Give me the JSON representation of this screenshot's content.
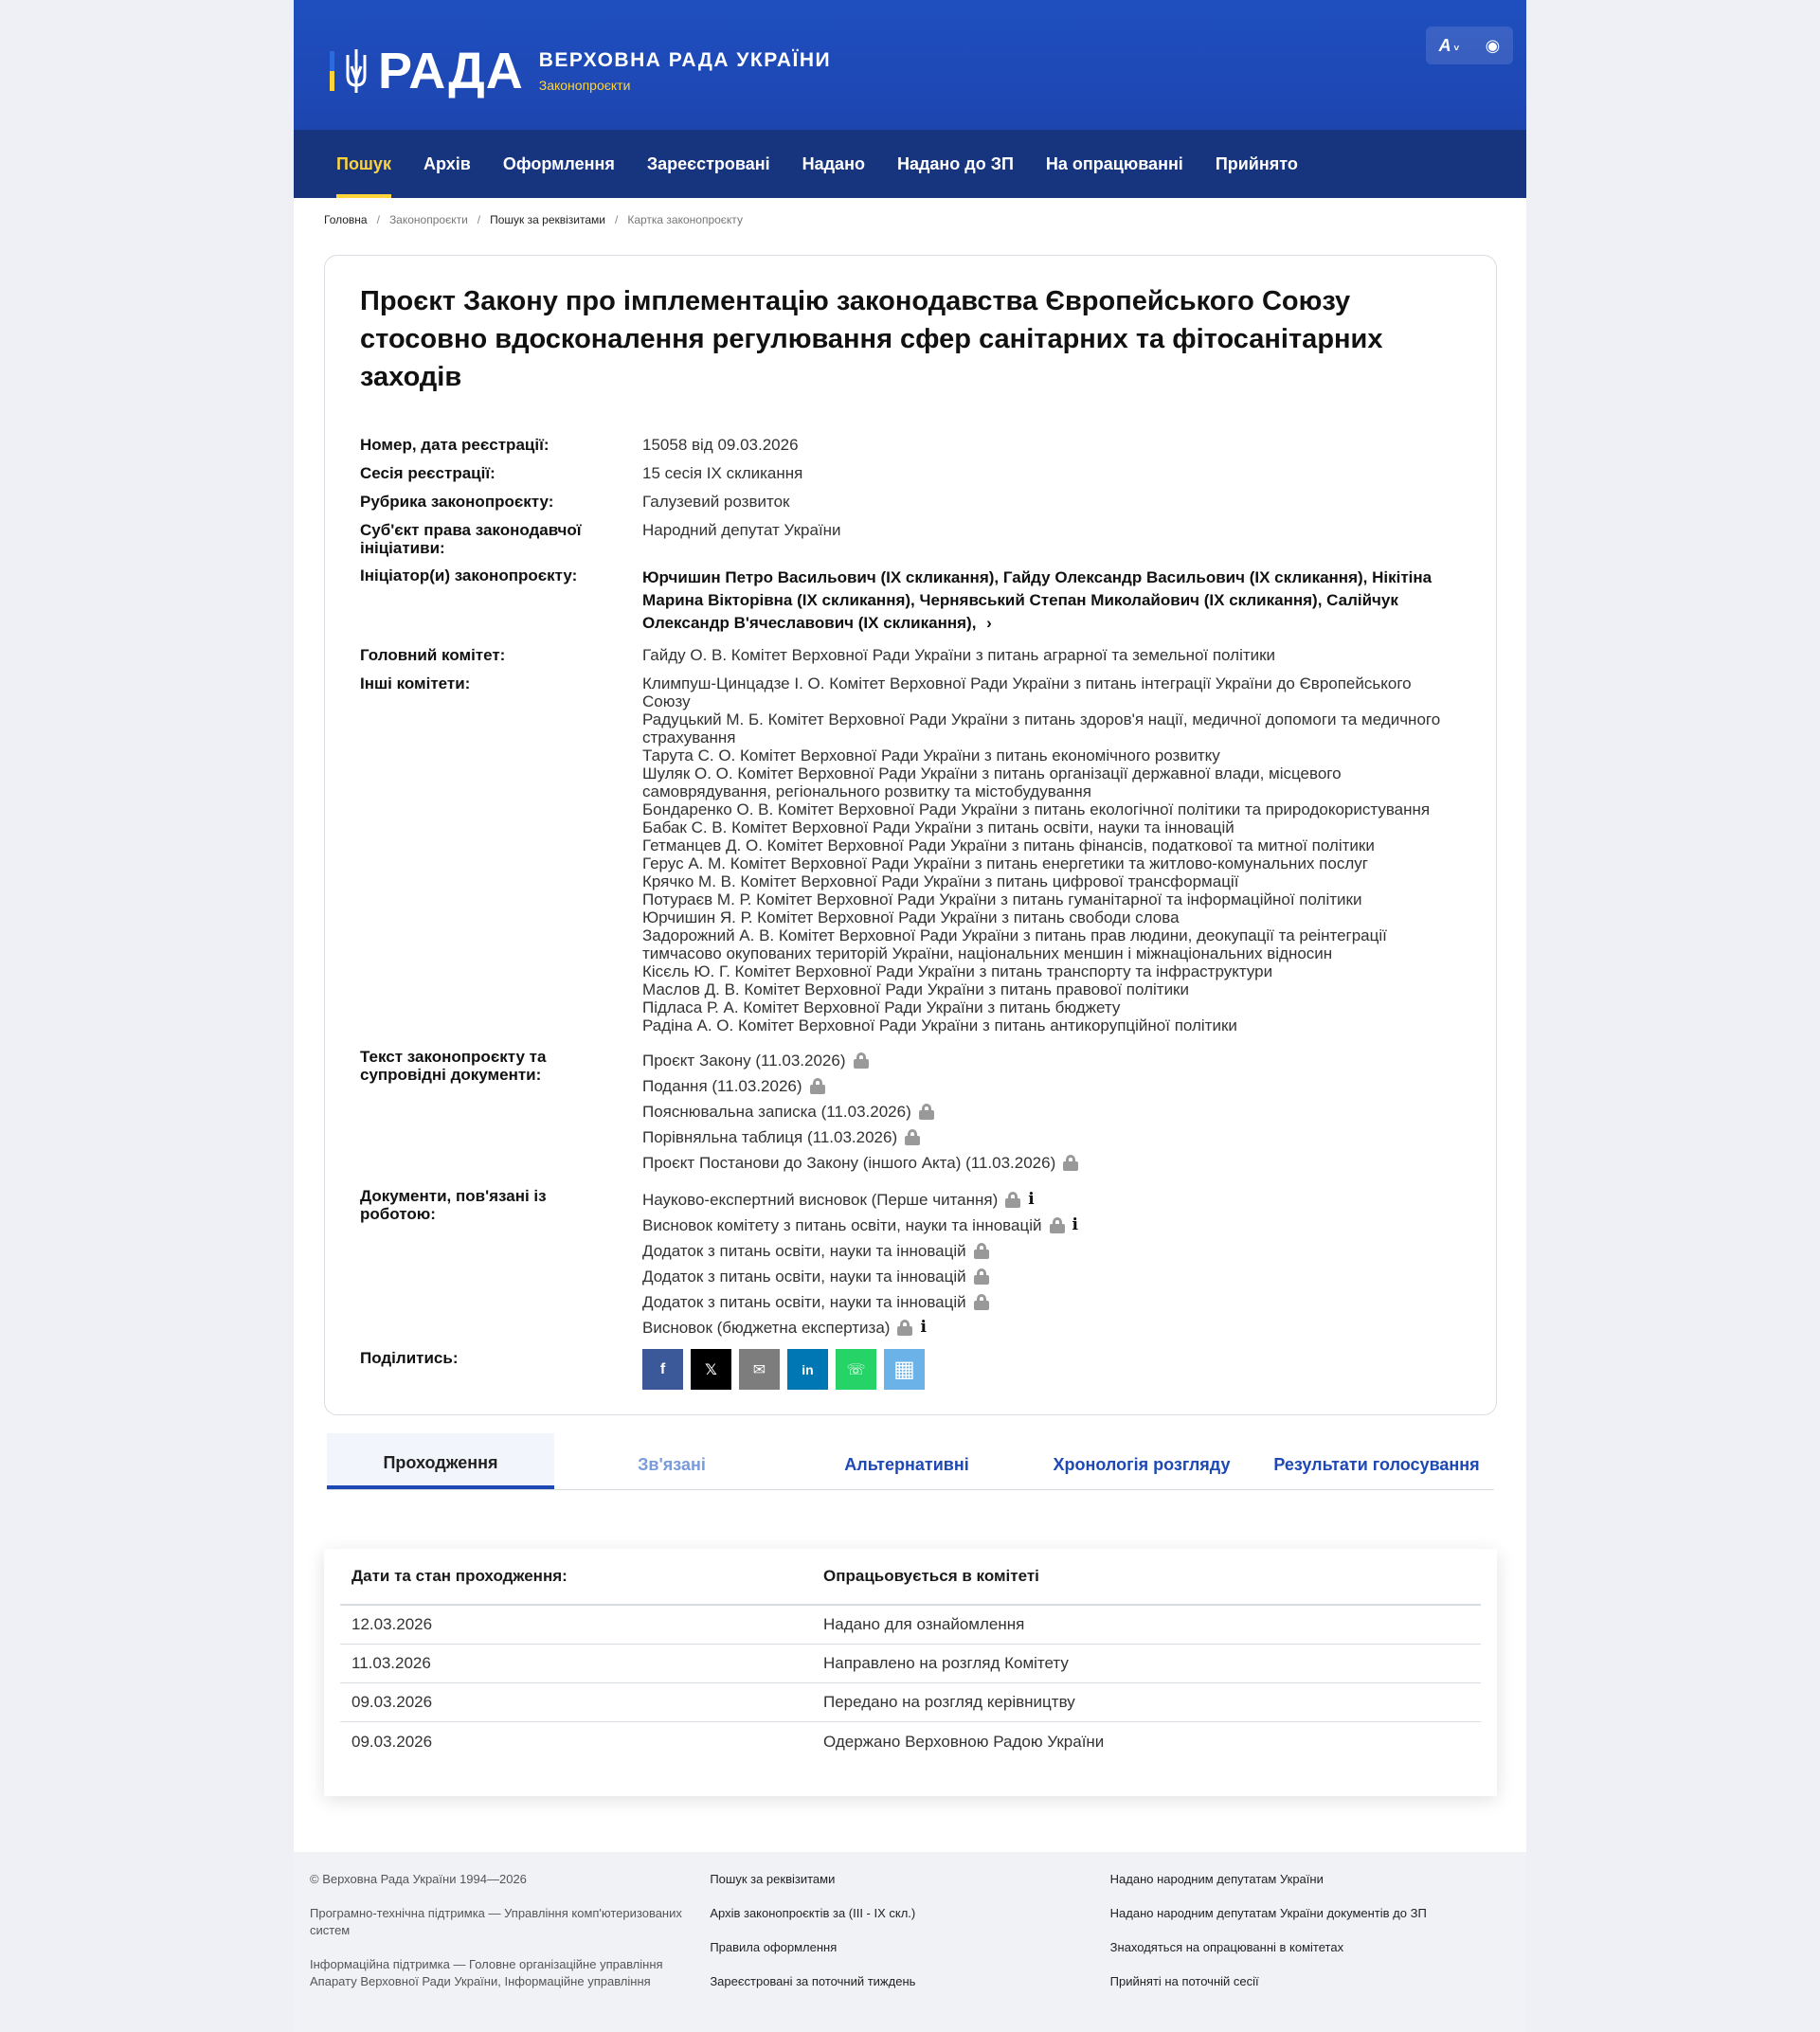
{
  "header": {
    "logo_word": "РАДА",
    "title": "ВЕРХОВНА РАДА УКРАЇНИ",
    "subtitle": "Законопроєкти",
    "font_size_label": "A",
    "colors": {
      "brand_blue": "#1d45b0",
      "nav_blue": "#17357e",
      "accent_yellow": "#ffd43b"
    }
  },
  "nav": [
    {
      "label": "Пошук",
      "active": true
    },
    {
      "label": "Архів"
    },
    {
      "label": "Оформлення"
    },
    {
      "label": "Зареєстровані"
    },
    {
      "label": "Надано"
    },
    {
      "label": "Надано до ЗП"
    },
    {
      "label": "На опрацюванні"
    },
    {
      "label": "Прийнято"
    }
  ],
  "breadcrumb": [
    "Головна",
    "Законопроєкти",
    "Пошук за реквізитами",
    "Картка законопроєкту"
  ],
  "bill": {
    "title": "Проєкт Закону про імплементацію законодавства Європейського Союзу стосовно вдосконалення регулювання сфер санітарних та фітосанітарних заходів",
    "number_label": "Номер, дата реєстрації:",
    "number_value": "15058 від 09.03.2026",
    "session_label": "Сесія реєстрації:",
    "session_value": "15 сесія IX скликання",
    "rubric_label": "Рубрика законопроєкту:",
    "rubric_value": "Галузевий розвиток",
    "subject_label": "Суб'єкт права законодавчої ініціативи:",
    "subject_value": "Народний депутат України",
    "initiators_label": "Ініціатор(и) законопроєкту:",
    "initiators_value": "Юрчишин Петро Васильович (IX скликання), Гайду Олександр Васильович (IX скликання), Нікітіна Марина Вікторівна (IX скликання), Чернявський Степан Миколайович (IX скликання), Салійчук Олександр В'ячеславович (IX скликання),",
    "initiators_more": "›",
    "main_committee_label": "Головний комітет:",
    "main_committee_value": "Гайду О. В. Комітет Верховної Ради України з питань аграрної та земельної політики",
    "other_committees_label": "Інші комітети:",
    "other_committees": [
      "Климпуш-Цинцадзе І. О. Комітет Верховної Ради України з питань інтеграції України до Європейського Союзу",
      "Радуцький М. Б. Комітет Верховної Ради України з питань здоров'я нації, медичної допомоги та медичного страхування",
      "Тарута С. О. Комітет Верховної Ради України з питань економічного розвитку",
      "Шуляк О. О. Комітет Верховної Ради України з питань організації державної влади, місцевого самоврядування, регіонального розвитку та містобудування",
      "Бондаренко О. В. Комітет Верховної Ради України з питань екологічної політики та природокористування",
      "Бабак С. В. Комітет Верховної Ради України з питань освіти, науки та інновацій",
      "Гетманцев Д. О. Комітет Верховної Ради України з питань фінансів, податкової та митної політики",
      "Герус А. М. Комітет Верховної Ради України з питань енергетики та житлово-комунальних послуг",
      "Крячко М. В. Комітет Верховної Ради України з питань цифрової трансформації",
      "Потураєв М. Р. Комітет Верховної Ради України з питань гуманітарної та інформаційної політики",
      "Юрчишин Я. Р. Комітет Верховної Ради України з питань свободи слова",
      "Задорожний А. В. Комітет Верховної Ради України з питань прав людини, деокупації та реінтеграції тимчасово окупованих територій України, національних меншин і міжнаціональних відносин",
      "Кісєль Ю. Г. Комітет Верховної Ради України з питань транспорту та інфраструктури",
      "Маслов Д. В. Комітет Верховної Ради України з питань правової політики",
      "Підласа Р. А. Комітет Верховної Ради України з питань бюджету",
      "Радіна А. О. Комітет Верховної Ради України з питань антикорупційної політики"
    ],
    "texts_label": "Текст законопроєкту та супровідні документи:",
    "texts": [
      "Проєкт Закону (11.03.2026)",
      "Подання (11.03.2026)",
      "Пояснювальна записка (11.03.2026)",
      "Порівняльна таблиця (11.03.2026)",
      "Проєкт Постанови до Закону (іншого Акта) (11.03.2026)"
    ],
    "work_docs_label": "Документи, пов'язані із роботою:",
    "work_docs": [
      {
        "label": "Науково-експертний висновок (Перше читання)",
        "info": true
      },
      {
        "label": "Висновок комітету з питань освіти, науки та інновацій",
        "info": true
      },
      {
        "label": "Додаток з питань освіти, науки та інновацій",
        "info": false
      },
      {
        "label": "Додаток з питань освіти, науки та інновацій",
        "info": false
      },
      {
        "label": "Додаток з питань освіти, науки та інновацій",
        "info": false
      },
      {
        "label": "Висновок (бюджетна експертиза)",
        "info": true
      }
    ],
    "share_label": "Поділитись:",
    "share_buttons": [
      {
        "name": "facebook",
        "glyph": "f",
        "color": "#3b5998"
      },
      {
        "name": "x",
        "glyph": "𝕏",
        "color": "#000000"
      },
      {
        "name": "email",
        "glyph": "✉",
        "color": "#7d7d7d"
      },
      {
        "name": "linkedin",
        "glyph": "in",
        "color": "#0077b5"
      },
      {
        "name": "whatsapp",
        "glyph": "☏",
        "color": "#25d366"
      },
      {
        "name": "qr",
        "glyph": "▦",
        "color": "#6ab2e7"
      }
    ]
  },
  "tabs": [
    {
      "label": "Проходження",
      "active": true
    },
    {
      "label": "Зв'язані",
      "dim": true
    },
    {
      "label": "Альтернативні"
    },
    {
      "label": "Хронологія розгляду"
    },
    {
      "label": "Результати голосування"
    }
  ],
  "status": {
    "head_left": "Дати та стан проходження:",
    "head_right": "Опрацьовується в комітеті",
    "rows": [
      {
        "date": "12.03.2026",
        "state": "Надано для ознайомлення"
      },
      {
        "date": "11.03.2026",
        "state": "Направлено на розгляд Комітету"
      },
      {
        "date": "09.03.2026",
        "state": "Передано на розгляд керівництву"
      },
      {
        "date": "09.03.2026",
        "state": "Одержано Верховною Радою України"
      }
    ]
  },
  "footer": {
    "col1": [
      "© Верховна Рада України 1994—2026",
      "Програмно-технічна підтримка — Управління комп'ютеризованих систем",
      "Інформаційна підтримка — Головне організаційне управління Апарату Верховної Ради України, Інформаційне управління"
    ],
    "col2": [
      "Пошук за реквізитами",
      "Архів законопроєктів за (III - IX скл.)",
      "Правила оформлення",
      "Зареєстровані за поточний тиждень"
    ],
    "col3": [
      "Надано народним депутатам України",
      "Надано народним депутатам України документів до ЗП",
      "Знаходяться на опрацюванні в комітетах",
      "Прийняті на поточній сесії"
    ]
  }
}
